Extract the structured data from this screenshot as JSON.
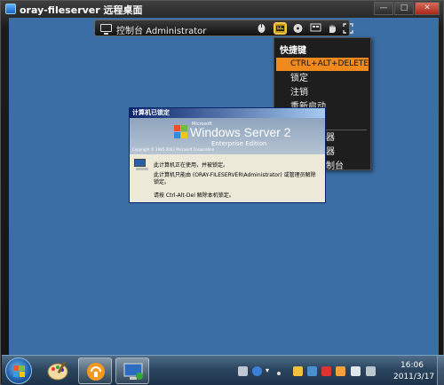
{
  "window": {
    "title": "oray-fileserver 远程桌面",
    "buttons": {
      "minimize": "—",
      "maximize": "□",
      "close": "✕"
    }
  },
  "toolbar": {
    "label": "控制台 Administrator",
    "icons": [
      "monitor-icon",
      "mouse-icon",
      "keyboard-icon",
      "disk-icon",
      "display-icon",
      "hand-icon",
      "fullscreen-icon"
    ]
  },
  "menu": {
    "header": "快捷键",
    "items": [
      "CTRL+ALT+DELETE",
      "锁定",
      "注销",
      "重新启动",
      "关机",
      "资源管理器",
      "任务管理器",
      "计算机控制台"
    ],
    "highlighted_index": 0
  },
  "dialog": {
    "title": "计算机已锁定",
    "banner": {
      "ms": "Microsoft",
      "product": "Windows Server 2",
      "edition": "Enterprise Edition",
      "copyright": "Copyright © 1985-2003 Microsoft Corporation"
    },
    "line1": "此计算机正在使用，并被锁定。",
    "line2": "此计算机只能由 (ORAY-FILESERVER\\Administrator) 或管理员解除",
    "line3": "锁定。",
    "line4": "请按 Ctrl-Alt-Del 解除本机锁定。"
  },
  "taskbar": {
    "clock_time": "16:06",
    "clock_date": "2011/3/17"
  },
  "colors": {
    "desktop": "#3a6ea5",
    "menu_highlight": "#f08a1c",
    "taskbar": "#2c4660"
  }
}
